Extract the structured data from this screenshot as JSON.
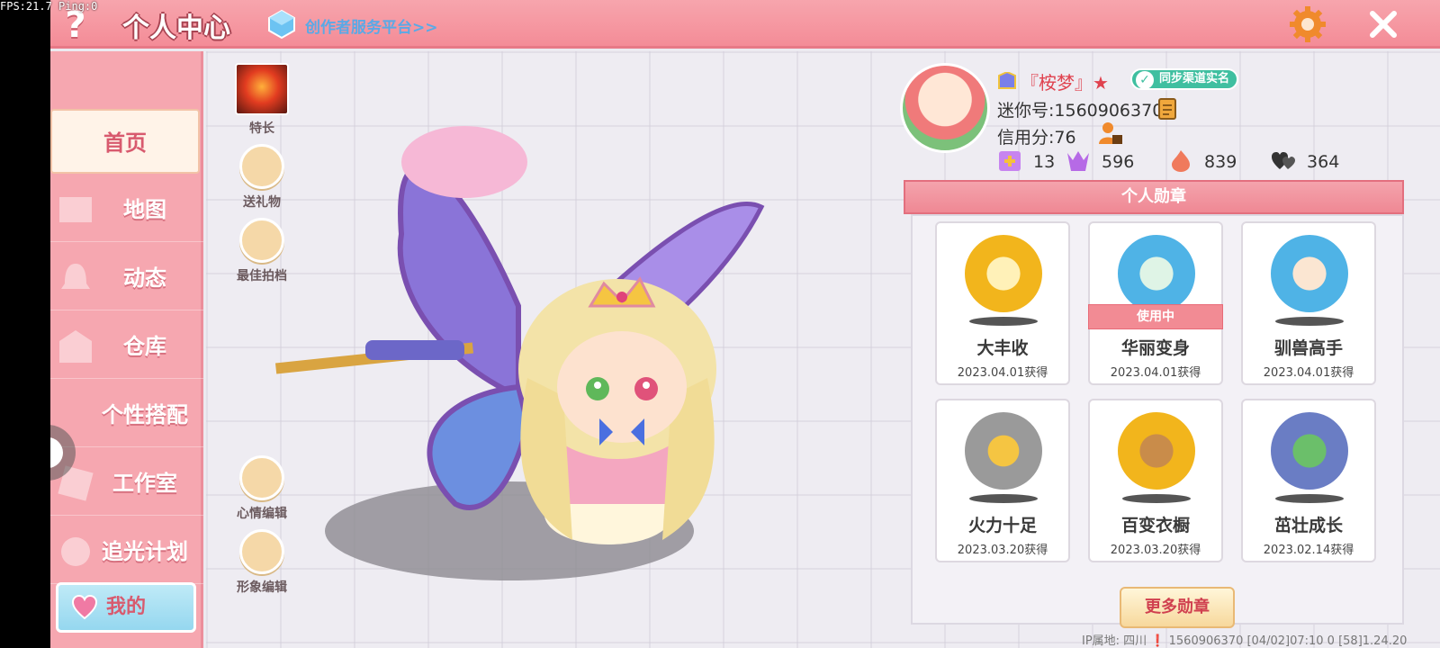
{
  "debug": {
    "text": "FPS:21.7  Ping:0"
  },
  "header": {
    "help_glyph": "?",
    "title": "个人中心",
    "creator_link": "创作者服务平台>>"
  },
  "sidebar": {
    "items": [
      {
        "label": "首页",
        "active": true
      },
      {
        "label": "地图"
      },
      {
        "label": "动态"
      },
      {
        "label": "仓库"
      },
      {
        "label": "个性搭配"
      },
      {
        "label": "工作室"
      },
      {
        "label": "追光计划"
      }
    ],
    "my_label": "我的"
  },
  "actions": {
    "specialty": "特长",
    "gift": "送礼物",
    "partner": "最佳拍档",
    "mood_edit": "心情编辑",
    "image_edit": "形象编辑"
  },
  "profile": {
    "name": "『桉梦』★",
    "sync_label": "同步渠道实名",
    "mini_id": "迷你号:1560906370",
    "credit": "信用分:76",
    "stats": [
      {
        "icon": "plus-card-icon",
        "value": "13"
      },
      {
        "icon": "cheer-icon",
        "value": "596"
      },
      {
        "icon": "flame-icon",
        "value": "839"
      },
      {
        "icon": "hearts-icon",
        "value": "364"
      }
    ]
  },
  "medals": {
    "header": "个人勋章",
    "items": [
      {
        "name": "大丰收",
        "date": "2023.04.01获得",
        "color": "#f2b51c"
      },
      {
        "name": "华丽变身",
        "date": "2023.04.01获得",
        "color": "#4fb3e6",
        "in_use": "使用中"
      },
      {
        "name": "驯兽高手",
        "date": "2023.04.01获得",
        "color": "#4fb3e6"
      },
      {
        "name": "火力十足",
        "date": "2023.03.20获得",
        "color": "#9a9a9a"
      },
      {
        "name": "百变衣橱",
        "date": "2023.03.20获得",
        "color": "#f2b51c"
      },
      {
        "name": "茁壮成长",
        "date": "2023.02.14获得",
        "color": "#6a7dc4"
      }
    ],
    "more_label": "更多勋章"
  },
  "footer": {
    "text": "IP属地: 四川 ❗   1560906370   [04/02]07:10 0   [58]1.24.20"
  },
  "colors": {
    "accent": "#f48c97",
    "sidebar": "#f6a7b0",
    "medal_gold": "#f2b51c"
  }
}
